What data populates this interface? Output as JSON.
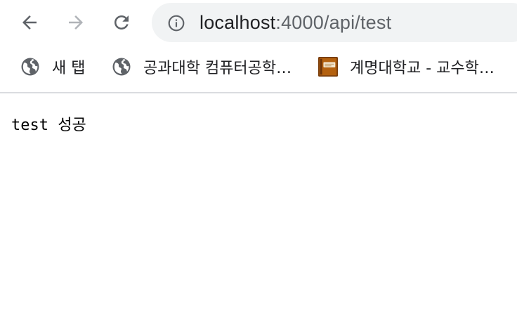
{
  "toolbar": {
    "back_icon": "arrow-left-icon",
    "forward_icon": "arrow-right-icon",
    "reload_icon": "reload-icon",
    "site_info_icon": "info-circle-icon",
    "url_host": "localhost",
    "url_path": ":4000/api/test"
  },
  "bookmarks": {
    "items": [
      {
        "label": "새 탭",
        "icon": "globe-icon"
      },
      {
        "label": "공과대학 컴퓨터공학…",
        "icon": "globe-icon"
      },
      {
        "label": "계명대학교 - 교수학…",
        "icon": "book-icon"
      }
    ]
  },
  "page": {
    "body_text": "test 성공"
  },
  "colors": {
    "omnibox_bg": "#f1f3f4",
    "icon_active": "#5f6368",
    "icon_disabled": "#b0b3b8",
    "divider": "#dadce0"
  }
}
